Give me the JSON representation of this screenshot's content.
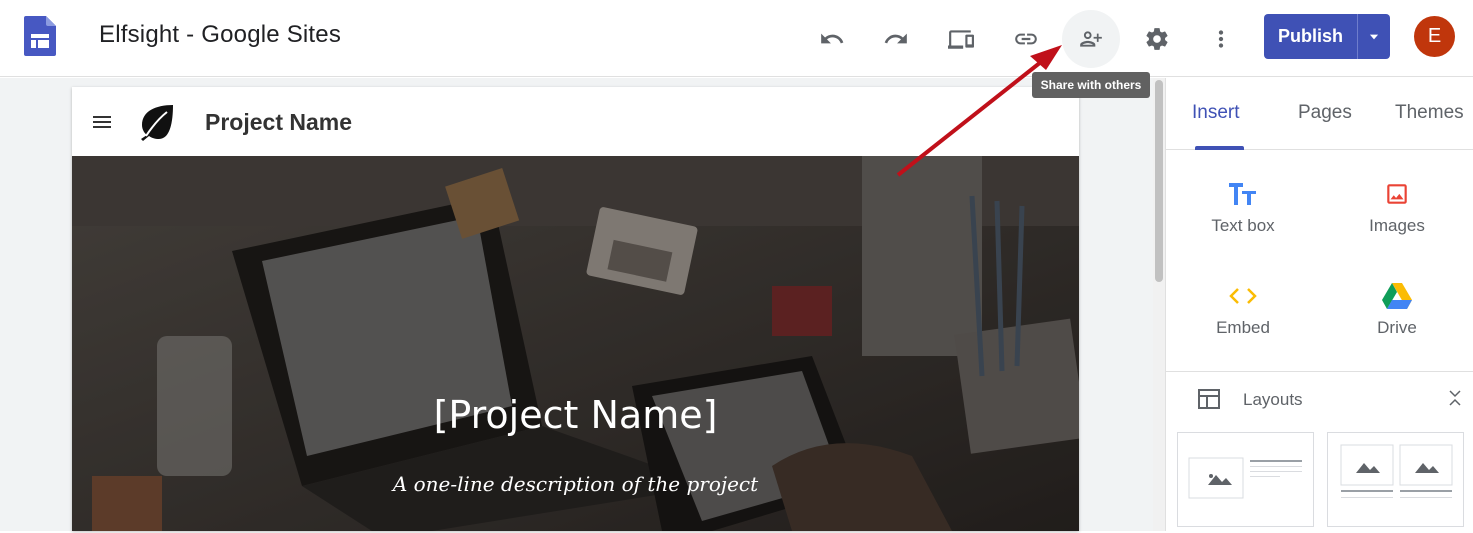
{
  "app": {
    "title": "Elfsight - Google Sites",
    "logo_icon": "google-sites-logo",
    "accent": "#3f51b5"
  },
  "toolbar": {
    "buttons": [
      {
        "name": "undo-icon",
        "label": "Undo"
      },
      {
        "name": "redo-icon",
        "label": "Redo"
      },
      {
        "name": "preview-icon",
        "label": "Preview"
      },
      {
        "name": "link-icon",
        "label": "Copy link"
      },
      {
        "name": "share-icon",
        "label": "Share with others"
      },
      {
        "name": "settings-icon",
        "label": "Settings"
      },
      {
        "name": "more-vert-icon",
        "label": "More"
      }
    ],
    "tooltip": "Share with others",
    "publish_label": "Publish",
    "avatar_initial": "E",
    "avatar_color": "#c0360c"
  },
  "site": {
    "nav_name": "Project Name",
    "hero_title": "[Project Name]",
    "hero_subtitle": "A one-line description of the project"
  },
  "panel": {
    "tabs": [
      {
        "label": "Insert",
        "active": true
      },
      {
        "label": "Pages",
        "active": false
      },
      {
        "label": "Themes",
        "active": false
      }
    ],
    "insert_items": [
      {
        "label": "Text box",
        "icon": "text-box-icon"
      },
      {
        "label": "Images",
        "icon": "image-icon"
      },
      {
        "label": "Embed",
        "icon": "embed-icon"
      },
      {
        "label": "Drive",
        "icon": "drive-icon"
      }
    ],
    "layouts_label": "Layouts"
  },
  "annotation": {
    "arrow_color": "#c0101a",
    "points_to": "share-button"
  }
}
